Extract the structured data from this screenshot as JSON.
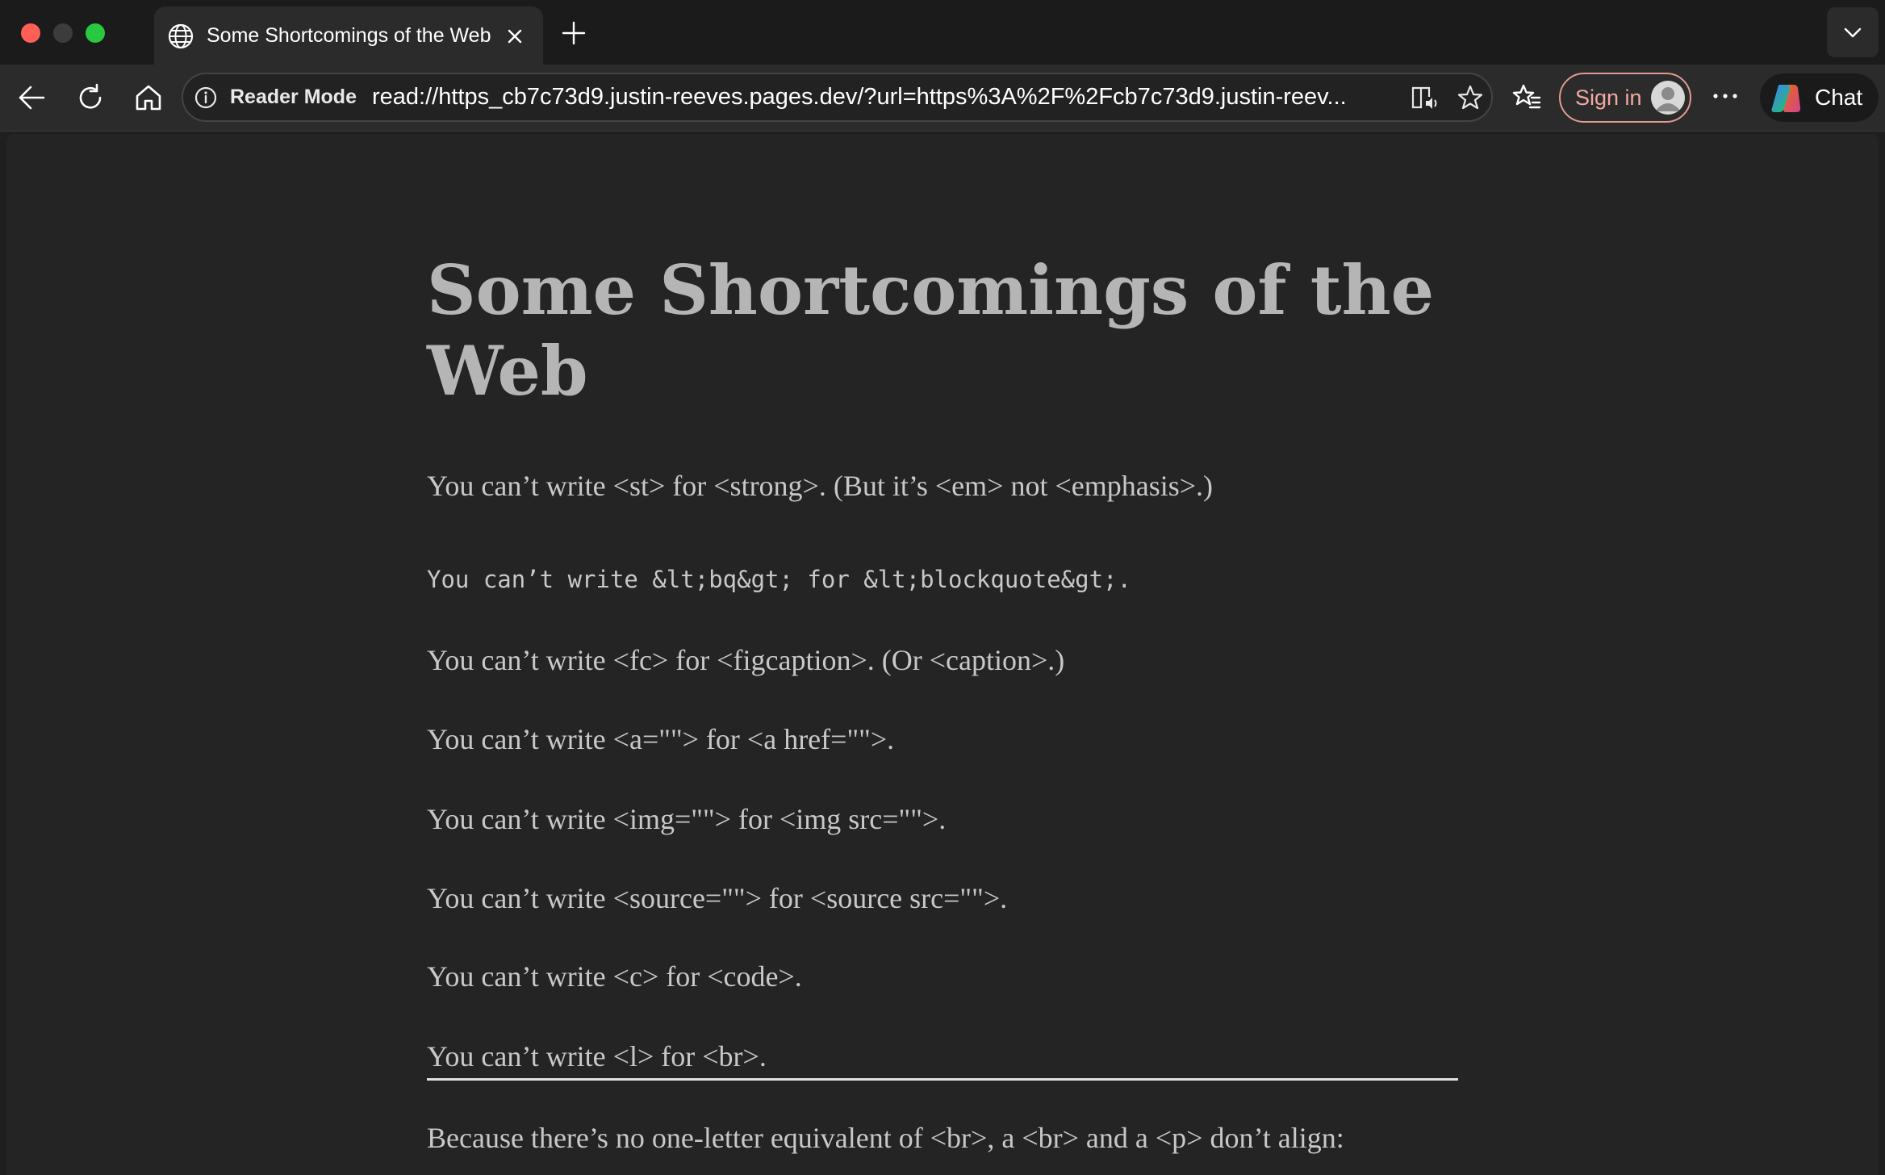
{
  "window": {
    "tab": {
      "title": "Some Shortcomings of the Web"
    }
  },
  "toolbar": {
    "address_bar": {
      "mode_label": "Reader Mode",
      "url": "read://https_cb7c73d9.justin-reeves.pages.dev/?url=https%3A%2F%2Fcb7c73d9.justin-reev..."
    },
    "sign_in_label": "Sign in",
    "chat_label": "Chat"
  },
  "article": {
    "title": "Some Shortcomings of the Web",
    "paragraphs": [
      "You can’t write <st> for <strong>. (But it’s <em> not <emphasis>.)",
      "You can’t write &lt;bq&gt; for &lt;blockquote&gt;.",
      "You can’t write <fc> for <figcaption>. (Or <caption>.)",
      "You can’t write <a=\"\"> for <a href=\"\">.",
      "You can’t write <img=\"\"> for <img src=\"\">.",
      "You can’t write <source=\"\"> for <source src=\"\">.",
      "You can’t write <c> for <code>.",
      "You can’t write <l> for <br>.",
      "Because there’s no one-letter equivalent of <br>, a <br> and a <p> don’t align:"
    ]
  },
  "colors": {
    "window_bg": "#1f1f1f",
    "toolbar_bg": "#2b2b2b",
    "content_bg": "#242424",
    "title_text": "#b5b5b5",
    "body_text": "#c8c8c8",
    "sign_in_accent": "#f2a9a3"
  },
  "icons": {
    "tab": "globe-icon",
    "close": "close-icon",
    "new_tab": "plus-icon",
    "tab_list": "chevron-down-icon",
    "back": "back-arrow-icon",
    "reload": "reload-icon",
    "home": "home-icon",
    "info": "info-icon",
    "immersive_reader": "immersive-reader-icon",
    "favorite": "star-icon",
    "favorites": "favorites-icon",
    "profile": "avatar-icon",
    "more": "more-icon",
    "copilot": "copilot-icon"
  }
}
